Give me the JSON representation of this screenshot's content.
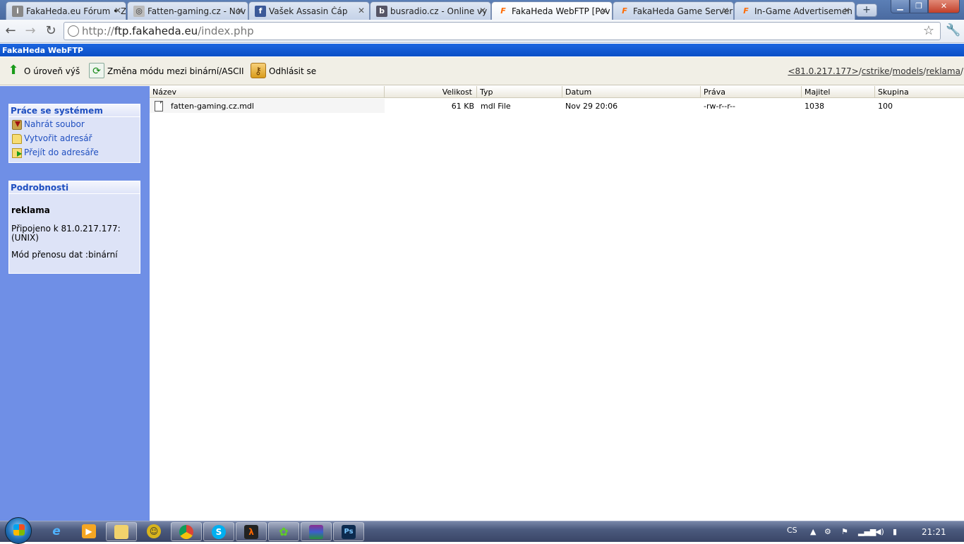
{
  "browser": {
    "tabs": [
      {
        "title": "FakaHeda.eu Fórum • Z",
        "icon": "forum-icon"
      },
      {
        "title": "Fatten-gaming.cz - Nov",
        "icon": "fatten-gaming-icon"
      },
      {
        "title": "Vašek Assasin Čáp",
        "icon": "facebook-icon"
      },
      {
        "title": "busradio.cz - Online vy",
        "icon": "busradio-icon"
      },
      {
        "title": "FakaHeda WebFTP [Pov",
        "icon": "fakaheda-icon",
        "active": true
      },
      {
        "title": "FakaHeda Game Server",
        "icon": "fakaheda-icon"
      },
      {
        "title": "In-Game Advertisemen",
        "icon": "fakaheda-icon"
      }
    ],
    "url_proto": "http://",
    "url_host": "ftp.fakaheda.eu",
    "url_path": "/index.php"
  },
  "app": {
    "title": "FakaHeda WebFTP",
    "toolbar": {
      "up_label": "O úroveň výš",
      "mode_label": "Změna módu mezi binární/ASCII",
      "logout_label": "Odhlásit se"
    },
    "path": [
      {
        "label": "<81.0.217.177>"
      },
      {
        "label": "cstrike"
      },
      {
        "label": "models"
      },
      {
        "label": "reklama"
      }
    ],
    "path_sep": "/"
  },
  "sidebar": {
    "system": {
      "title": "Práce se systémem",
      "items": [
        "Nahrát soubor",
        "Vytvořit adresář",
        "Přejít do adresáře"
      ]
    },
    "details": {
      "title": "Podrobnosti",
      "name": "reklama",
      "connected_line1": "Připojeno k 81.0.217.177:",
      "connected_line2": "(UNIX)",
      "mode": "Mód přenosu dat :binární"
    }
  },
  "filelist": {
    "columns": [
      "Název",
      "Velikost",
      "Typ",
      "Datum",
      "Práva",
      "Majitel",
      "Skupina"
    ],
    "rows": [
      {
        "name": "fatten-gaming.cz.mdl",
        "size": "61 KB",
        "type": "mdl File",
        "date": "Nov 29 20:06",
        "perms": "-rw-r--r--",
        "owner": "1038",
        "group": "100"
      }
    ]
  },
  "taskbar": {
    "lang": "CS",
    "time": "21:21"
  }
}
